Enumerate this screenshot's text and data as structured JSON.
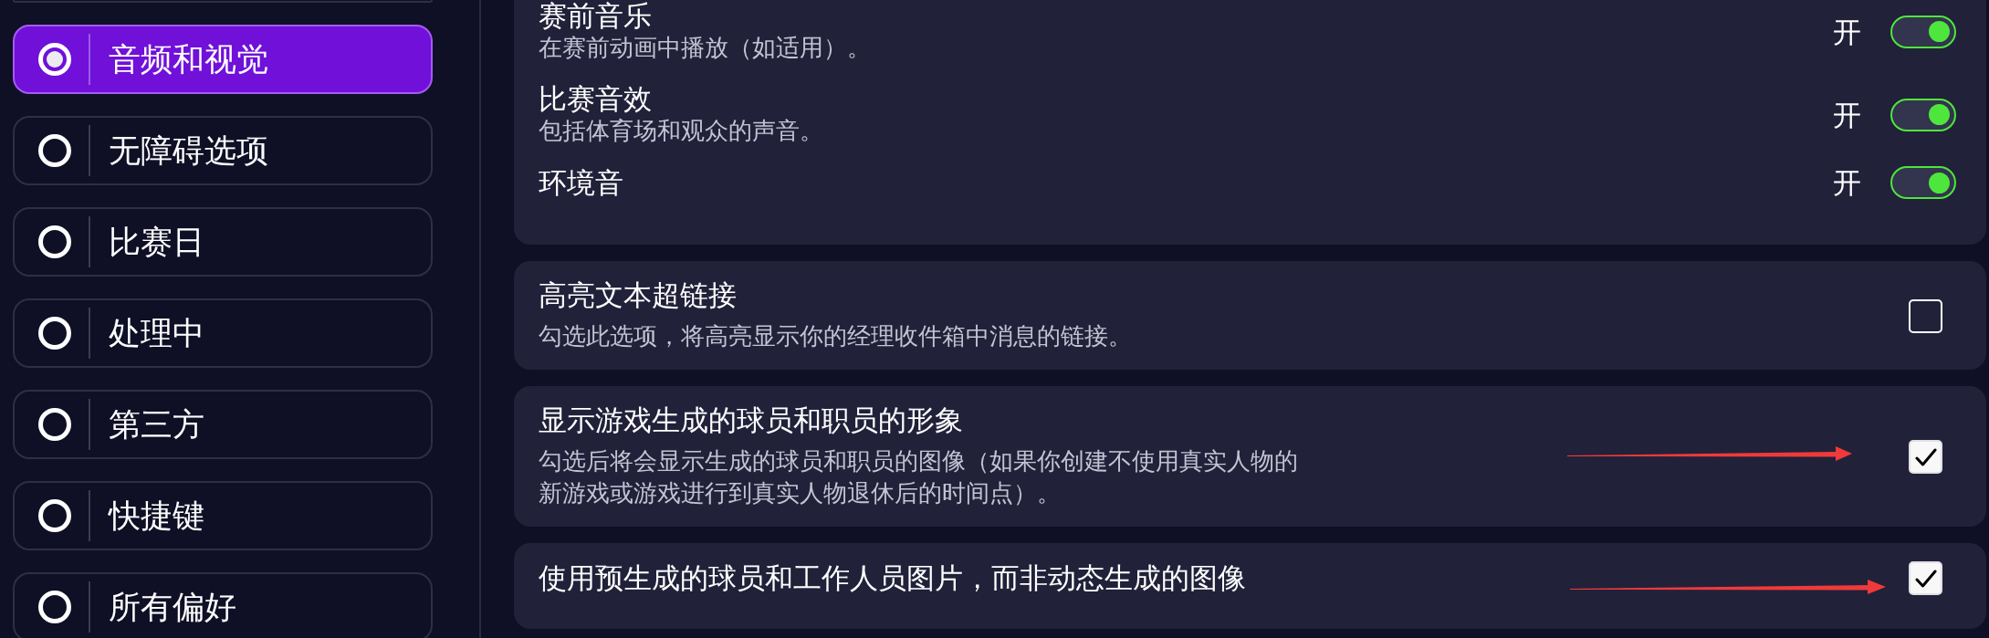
{
  "sidebar": {
    "items": [
      {
        "label": "音频和视觉",
        "selected": true
      },
      {
        "label": "无障碍选项",
        "selected": false
      },
      {
        "label": "比赛日",
        "selected": false
      },
      {
        "label": "处理中",
        "selected": false
      },
      {
        "label": "第三方",
        "selected": false
      },
      {
        "label": "快捷键",
        "selected": false
      },
      {
        "label": "所有偏好",
        "selected": false
      }
    ]
  },
  "audio_settings": {
    "rows": [
      {
        "title": "赛前音乐",
        "description": "在赛前动画中播放（如适用）。",
        "state_label": "开",
        "on": true
      },
      {
        "title": "比赛音效",
        "description": "包括体育场和观众的声音。",
        "state_label": "开",
        "on": true
      },
      {
        "title": "环境音",
        "state_label": "开",
        "on": true
      }
    ]
  },
  "options": [
    {
      "title": "高亮文本超链接",
      "description": "勾选此选项，将高亮显示你的经理收件箱中消息的链接。",
      "checked": false,
      "annotated": false
    },
    {
      "title": "显示游戏生成的球员和职员的形象",
      "description": "勾选后将会显示生成的球员和职员的图像（如果你创建不使用真实人物的新游戏或游戏进行到真实人物退休后的时间点）。",
      "checked": true,
      "annotated": true
    },
    {
      "title": "使用预生成的球员和工作人员图片，而非动态生成的图像",
      "checked": true,
      "annotated": true
    }
  ]
}
